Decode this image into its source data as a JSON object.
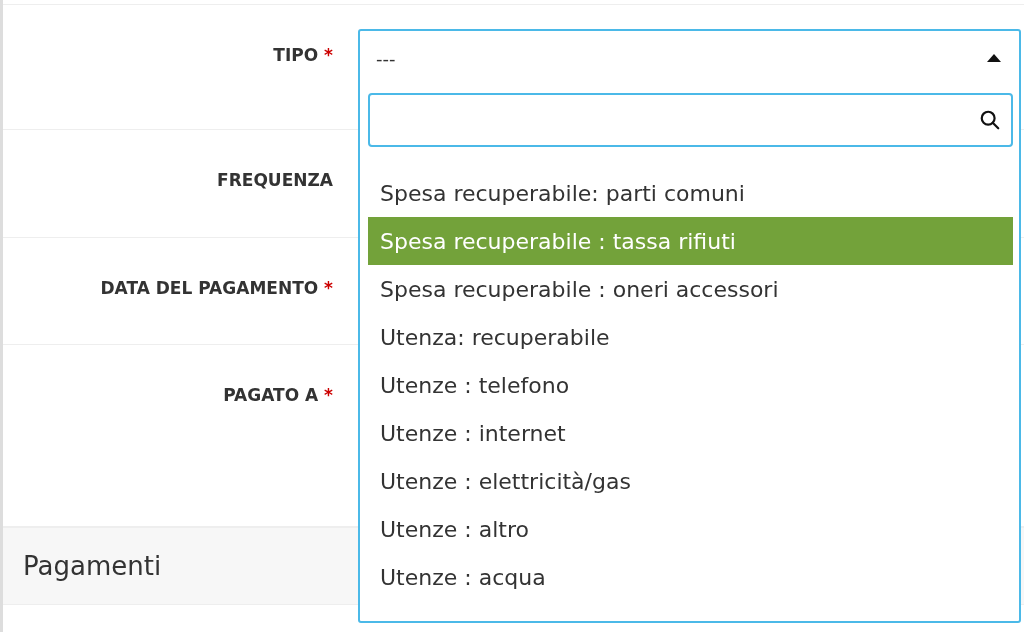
{
  "form": {
    "fields": [
      {
        "label": "TIPO",
        "required_mark": "*"
      },
      {
        "label": "FREQUENZA"
      },
      {
        "label": "DATA DEL PAGAMENTO",
        "required_mark": "*"
      },
      {
        "label": "PAGATO A",
        "required_mark": "*"
      }
    ]
  },
  "select": {
    "value": "---",
    "expanded": true,
    "options": [
      {
        "label": "Spesa recuperabile: parti comuni",
        "selected": false
      },
      {
        "label": "Spesa recuperabile : tassa rifiuti",
        "selected": true
      },
      {
        "label": "Spesa recuperabile : oneri accessori",
        "selected": false
      },
      {
        "label": "Utenza: recuperabile",
        "selected": false
      },
      {
        "label": "Utenze : telefono",
        "selected": false
      },
      {
        "label": "Utenze : internet",
        "selected": false
      },
      {
        "label": "Utenze : elettricità/gas",
        "selected": false
      },
      {
        "label": "Utenze : altro",
        "selected": false
      },
      {
        "label": "Utenze : acqua",
        "selected": false
      }
    ]
  },
  "section": {
    "title": "Pagamenti"
  }
}
